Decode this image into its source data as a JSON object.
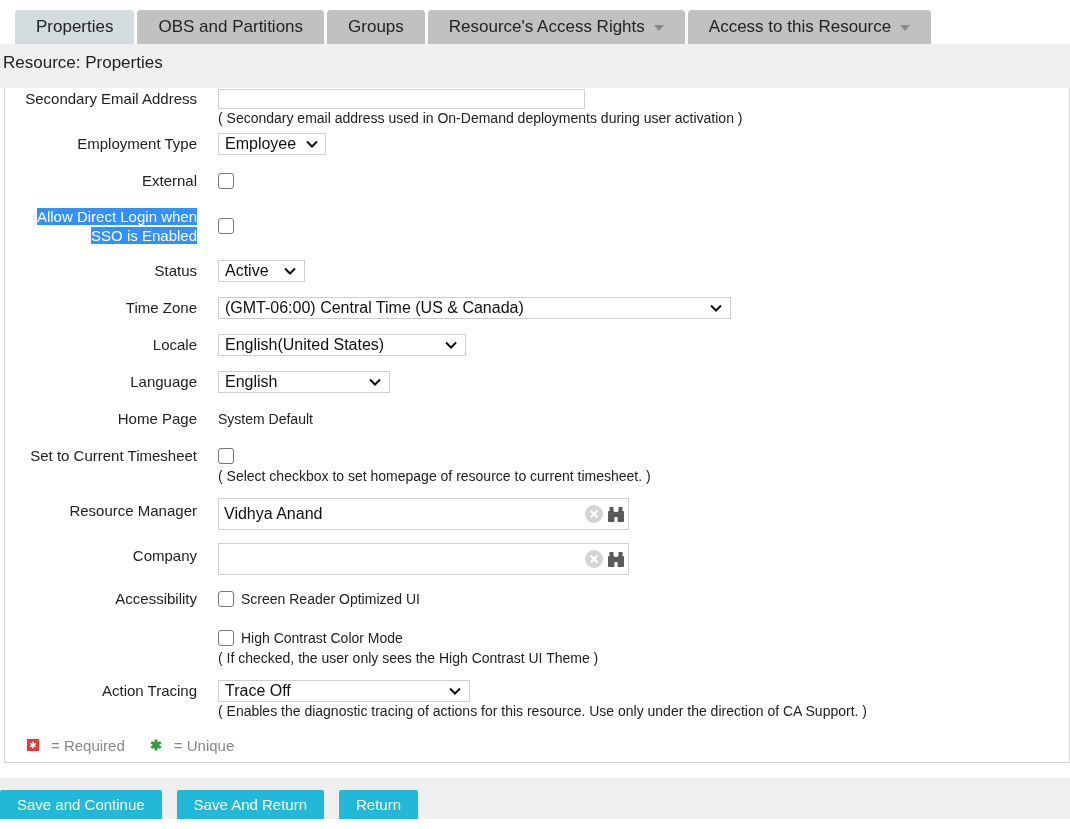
{
  "tabs": [
    {
      "label": "Properties",
      "selected": true,
      "has_menu": false
    },
    {
      "label": "OBS and Partitions",
      "selected": false,
      "has_menu": false
    },
    {
      "label": "Groups",
      "selected": false,
      "has_menu": false
    },
    {
      "label": "Resource's Access Rights",
      "selected": false,
      "has_menu": true
    },
    {
      "label": "Access to this Resource",
      "selected": false,
      "has_menu": true
    }
  ],
  "header": {
    "title": "Resource: Properties"
  },
  "fields": [
    {
      "kind": "text",
      "label": "Secondary Email Address",
      "highlighted": false,
      "hint": "( Secondary email address used in On-Demand deployments during user activation )"
    },
    {
      "kind": "select",
      "label": "Employment Type",
      "highlighted": false,
      "value": "Employee"
    },
    {
      "kind": "checkbox",
      "label": "External",
      "highlighted": false,
      "checked": false
    },
    {
      "kind": "checkbox",
      "label": "Allow Direct Login when SSO is Enabled",
      "highlighted": true,
      "checked": false
    },
    {
      "kind": "select",
      "label": "Status",
      "highlighted": false,
      "value": "Active"
    },
    {
      "kind": "select",
      "label": "Time Zone",
      "highlighted": false,
      "value": "(GMT-06:00) Central Time (US & Canada)"
    },
    {
      "kind": "select",
      "label": "Locale",
      "highlighted": false,
      "value": "English(United States)"
    },
    {
      "kind": "select",
      "label": "Language",
      "highlighted": false,
      "value": "English"
    },
    {
      "kind": "static",
      "label": "Home Page",
      "highlighted": false,
      "value": "System Default"
    },
    {
      "kind": "checkbox",
      "label": "Set to Current Timesheet",
      "highlighted": false,
      "checked": false,
      "hint": "( Select checkbox to set homepage of resource to current timesheet. )"
    },
    {
      "kind": "lookup",
      "label": "Resource Manager",
      "highlighted": false,
      "value": "Vidhya Anand"
    },
    {
      "kind": "lookup",
      "label": "Company",
      "highlighted": false
    },
    {
      "kind": "checkgroup",
      "label": "Accessibility",
      "highlighted": false,
      "options": [
        {
          "label": "Screen Reader Optimized UI",
          "checked": false
        },
        {
          "label": "High Contrast Color Mode",
          "checked": false,
          "hint": "( If checked, the user only sees the High Contrast UI Theme )"
        }
      ]
    },
    {
      "kind": "select",
      "label": "Action Tracing",
      "highlighted": false,
      "value": "Trace Off",
      "hint": "( Enables the diagnostic tracing of actions for this resource. Use only under the direction of CA Support. )"
    }
  ],
  "legend": [
    {
      "kind": "required",
      "label": "= Required"
    },
    {
      "kind": "unique",
      "label": "= Unique"
    }
  ],
  "buttons": [
    "Save and Continue",
    "Save And Return",
    "Return"
  ]
}
